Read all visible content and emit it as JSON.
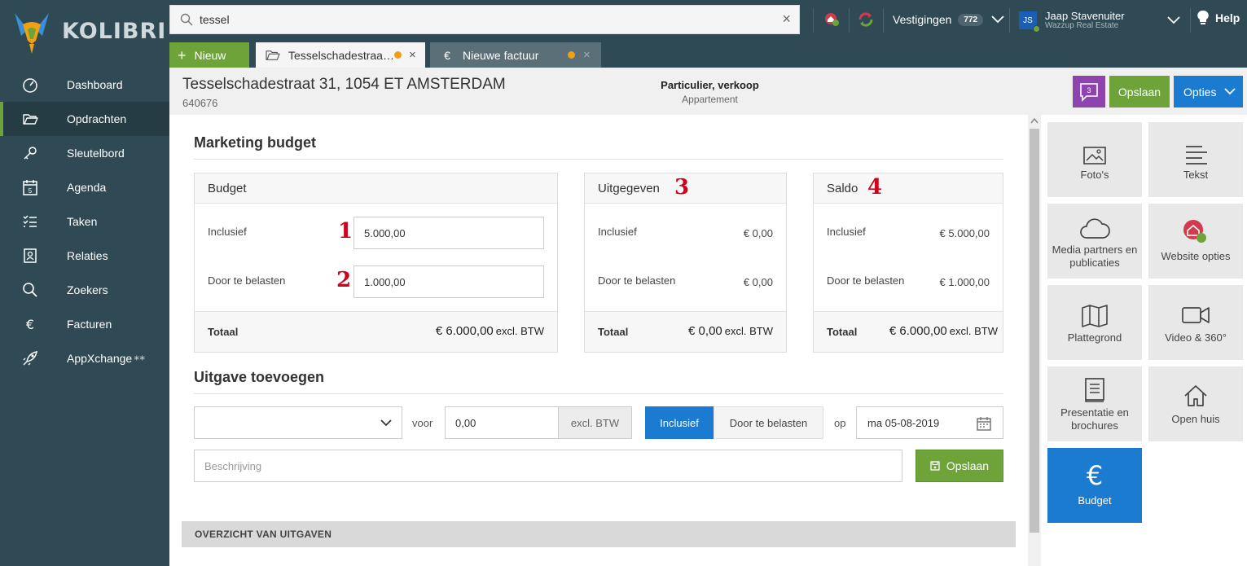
{
  "app": {
    "name": "KOLIBRI"
  },
  "sidebar": {
    "items": [
      {
        "label": "Dashboard",
        "icon": "dashboard-gauge-icon"
      },
      {
        "label": "Opdrachten",
        "icon": "folder-open-icon",
        "active": true
      },
      {
        "label": "Sleutelbord",
        "icon": "key-icon"
      },
      {
        "label": "Agenda",
        "icon": "calendar-icon",
        "icon_text": "5"
      },
      {
        "label": "Taken",
        "icon": "checklist-icon"
      },
      {
        "label": "Relaties",
        "icon": "contact-card-icon"
      },
      {
        "label": "Zoekers",
        "icon": "search-icon"
      },
      {
        "label": "Facturen",
        "icon": "euro-icon",
        "icon_text": "€"
      },
      {
        "label": "AppXchange",
        "icon": "rocket-icon",
        "suffix": "⁎⁎"
      }
    ]
  },
  "topbar": {
    "search_value": "tessel",
    "clear": "×",
    "vestigingen_label": "Vestigingen",
    "vestigingen_count": "772",
    "user_initials": "JS",
    "user_name": "Jaap Stavenuiter",
    "user_org": "Wazzup Real Estate",
    "help_label": "Help",
    "new_button": "Nieuw",
    "new_plus": "+",
    "tabs": [
      {
        "label": "Tesselschadestraa…",
        "icon": "folder-open-icon",
        "modified": true,
        "close": "×"
      },
      {
        "label": "Nieuwe factuur",
        "icon": "euro-icon",
        "icon_text": "€",
        "modified": true,
        "close": "×"
      }
    ]
  },
  "header": {
    "address": "Tesselschadestraat 31, 1054 ET AMSTERDAM",
    "id": "640676",
    "type": "Particulier, verkoop",
    "subtype": "Appartement",
    "chat_count": "3",
    "save_label": "Opslaan",
    "options_label": "Opties"
  },
  "budget": {
    "title": "Marketing budget",
    "cards": {
      "budget": {
        "title": "Budget",
        "rows": [
          {
            "label": "Inclusief",
            "value": "5.000,00",
            "marker": "1"
          },
          {
            "label": "Door te belasten",
            "value": "1.000,00",
            "marker": "2"
          }
        ],
        "total_label": "Totaal",
        "total_value": "€ 6.000,00",
        "total_suffix": "excl. BTW"
      },
      "spent": {
        "title": "Uitgegeven",
        "marker": "3",
        "rows": [
          {
            "label": "Inclusief",
            "value": "€ 0,00"
          },
          {
            "label": "Door te belasten",
            "value": "€ 0,00"
          }
        ],
        "total_label": "Totaal",
        "total_value": "€ 0,00",
        "total_suffix": "excl. BTW"
      },
      "balance": {
        "title": "Saldo",
        "marker": "4",
        "rows": [
          {
            "label": "Inclusief",
            "value": "€ 5.000,00"
          },
          {
            "label": "Door te belasten",
            "value": "€ 1.000,00"
          }
        ],
        "total_label": "Totaal",
        "total_value": "€ 6.000,00",
        "total_suffix": "excl. BTW"
      }
    }
  },
  "expense_form": {
    "title": "Uitgave toevoegen",
    "category_value": "",
    "voor_label": "voor",
    "amount_value": "0,00",
    "amount_suffix": "excl. BTW",
    "toggle_inclusief": "Inclusief",
    "toggle_door": "Door te belasten",
    "op_label": "op",
    "date_value": "ma 05-08-2019",
    "description_placeholder": "Beschrijving",
    "save_label": "Opslaan"
  },
  "overview": {
    "title": "OVERZICHT VAN UITGAVEN"
  },
  "tiles": [
    {
      "label": "Foto's",
      "icon": "image-icon"
    },
    {
      "label": "Tekst",
      "icon": "text-lines-icon"
    },
    {
      "label": "Media partners en publicaties",
      "icon": "cloud-icon"
    },
    {
      "label": "Website opties",
      "icon": "website-house-icon"
    },
    {
      "label": "Plattegrond",
      "icon": "map-icon"
    },
    {
      "label": "Video & 360°",
      "icon": "video-camera-icon"
    },
    {
      "label": "Presentatie en brochures",
      "icon": "brochure-icon"
    },
    {
      "label": "Open huis",
      "icon": "house-icon"
    },
    {
      "label": "Budget",
      "icon": "euro-icon",
      "icon_text": "€",
      "active": true
    }
  ],
  "colors": {
    "sidebar_bg": "#2f4a55",
    "accent_green": "#6ea33a",
    "accent_blue": "#1a7bd1",
    "chat_purple": "#8e44ad",
    "marker_red": "#d0021b",
    "modified_dot": "#f0a012"
  }
}
